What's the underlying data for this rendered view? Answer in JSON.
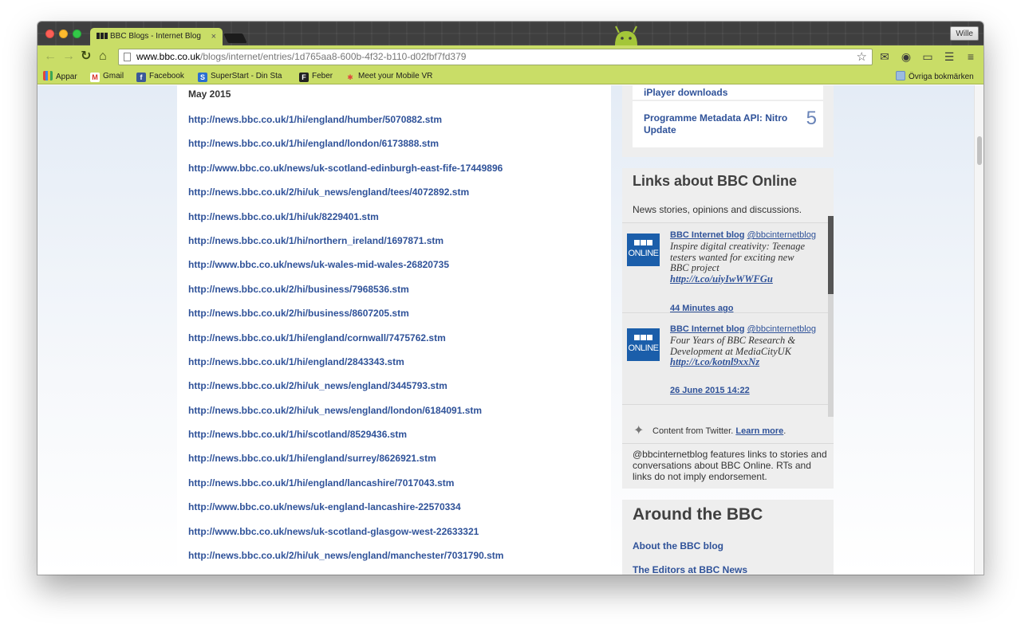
{
  "browser": {
    "tab_title": "BBC Blogs - Internet Blog",
    "tab_close": "×",
    "user_button": "Wille",
    "url_host": "www.bbc.co.uk",
    "url_path": "/blogs/internet/entries/1d765aa8-600b-4f32-b110-d02fbf7fd379",
    "bookmarks": [
      {
        "label": "Appar",
        "icon": "apps-icon"
      },
      {
        "label": "Gmail",
        "icon": "gmail-icon"
      },
      {
        "label": "Facebook",
        "icon": "facebook-icon"
      },
      {
        "label": "SuperStart - Din Sta",
        "icon": "superstart-icon"
      },
      {
        "label": "Feber",
        "icon": "feber-icon"
      },
      {
        "label": "Meet your Mobile VR",
        "icon": "meet-icon"
      }
    ],
    "other_bookmarks": "Övriga bokmärken"
  },
  "main": {
    "month": "May 2015",
    "links": [
      "http://news.bbc.co.uk/1/hi/england/humber/5070882.stm",
      "http://news.bbc.co.uk/1/hi/england/london/6173888.stm",
      "http://www.bbc.co.uk/news/uk-scotland-edinburgh-east-fife-17449896",
      "http://news.bbc.co.uk/2/hi/uk_news/england/tees/4072892.stm",
      "http://news.bbc.co.uk/1/hi/uk/8229401.stm",
      "http://news.bbc.co.uk/1/hi/northern_ireland/1697871.stm",
      "http://www.bbc.co.uk/news/uk-wales-mid-wales-26820735",
      "http://news.bbc.co.uk/2/hi/business/7968536.stm",
      "http://news.bbc.co.uk/2/hi/business/8607205.stm",
      "http://news.bbc.co.uk/1/hi/england/cornwall/7475762.stm",
      "http://news.bbc.co.uk/1/hi/england/2843343.stm",
      "http://news.bbc.co.uk/2/hi/uk_news/england/3445793.stm",
      "http://news.bbc.co.uk/2/hi/uk_news/england/london/6184091.stm",
      "http://news.bbc.co.uk/1/hi/scotland/8529436.stm",
      "http://news.bbc.co.uk/1/hi/england/surrey/8626921.stm",
      "http://news.bbc.co.uk/1/hi/england/lancashire/7017043.stm",
      "http://www.bbc.co.uk/news/uk-england-lancashire-22570334",
      "http://www.bbc.co.uk/news/uk-scotland-glasgow-west-22633321",
      "http://news.bbc.co.uk/2/hi/uk_news/england/manchester/7031790.stm"
    ]
  },
  "sidebar": {
    "popular_partial": "iPlayer downloads",
    "popular_item": {
      "title": "Programme Metadata API: Nitro Update",
      "rank": "5"
    },
    "links_about": {
      "title": "Links about BBC Online",
      "subtitle": "News stories, opinions and discussions.",
      "tweets": [
        {
          "author": "BBC Internet blog",
          "handle": "@bbcinternetblog",
          "text": "Inspire digital creativity: Teenage testers wanted for exciting new BBC project",
          "link": "http://t.co/uiyIwWWFGu",
          "time": "44 Minutes ago"
        },
        {
          "author": "BBC Internet blog",
          "handle": "@bbcinternetblog",
          "text": "Four Years of BBC Research & Development at MediaCityUK",
          "link": "http://t.co/kotnl9xxNz",
          "time": "26 June 2015 14:22"
        }
      ],
      "logo_blocks": [
        "B",
        "B",
        "C"
      ],
      "logo_text": "ONLINE",
      "twitter_credit_text": "Content from Twitter.",
      "twitter_learn_more": "Learn more",
      "endorsement": "@bbcinternetblog features links to stories and conversations about BBC Online. RTs and links do not imply endorsement."
    },
    "around": {
      "title": "Around the BBC",
      "links": [
        "About the BBC blog",
        "The Editors at BBC News"
      ]
    }
  },
  "colors": {
    "link": "#2f5299",
    "chrome_theme": "#c9dd67",
    "bbc_blue": "#1b5eaa"
  }
}
